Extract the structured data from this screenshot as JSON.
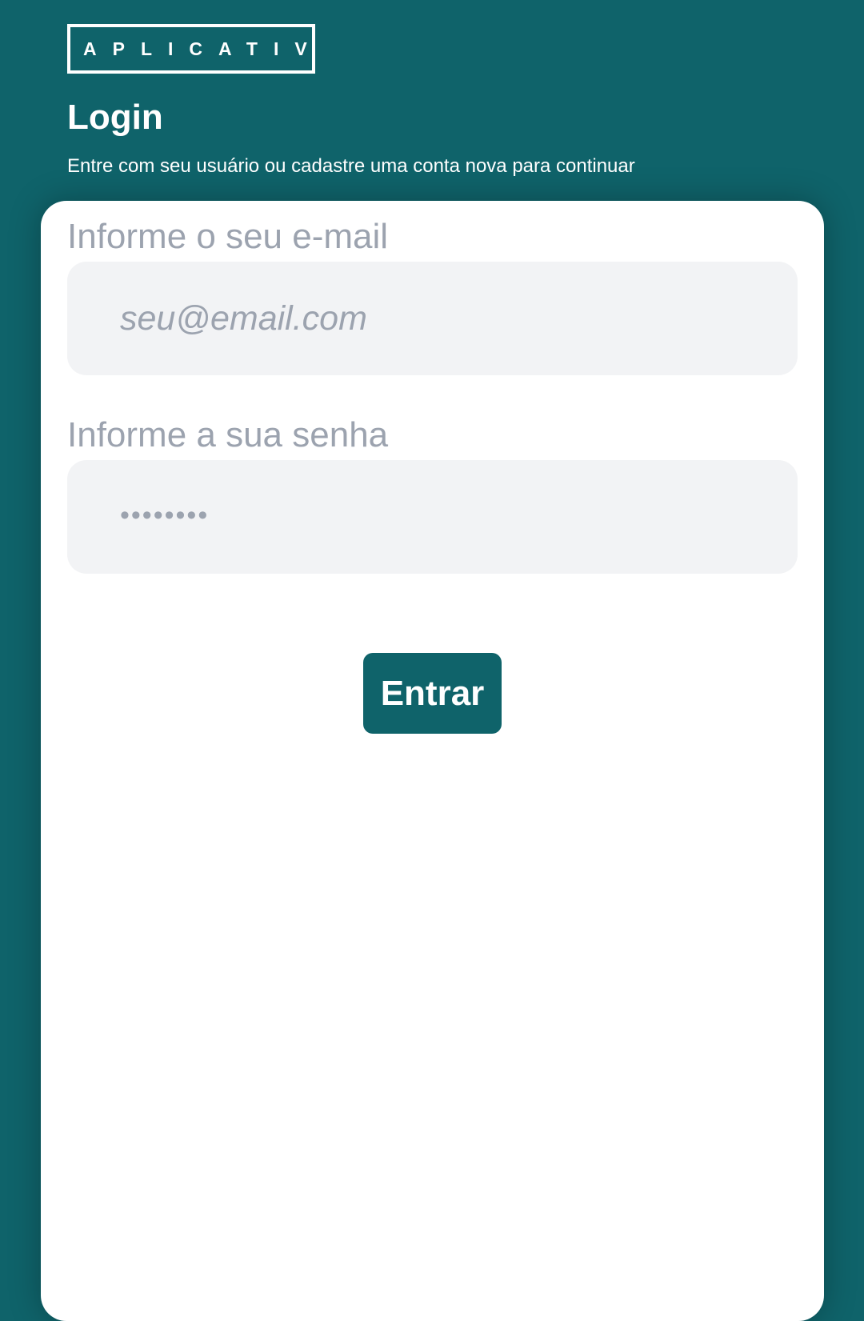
{
  "header": {
    "logo_text": "APLICATIVO",
    "title": "Login",
    "subtitle": "Entre com seu usuário ou cadastre uma conta nova para continuar"
  },
  "form": {
    "email": {
      "label": "Informe o seu e-mail",
      "placeholder": "seu@email.com",
      "value": ""
    },
    "password": {
      "label": "Informe a sua senha",
      "masked_value": "••••••••"
    },
    "submit_label": "Entrar"
  },
  "colors": {
    "brand": "#0f636a",
    "card": "#ffffff",
    "input_bg": "#f2f3f5",
    "muted_text": "#9ca3af"
  }
}
